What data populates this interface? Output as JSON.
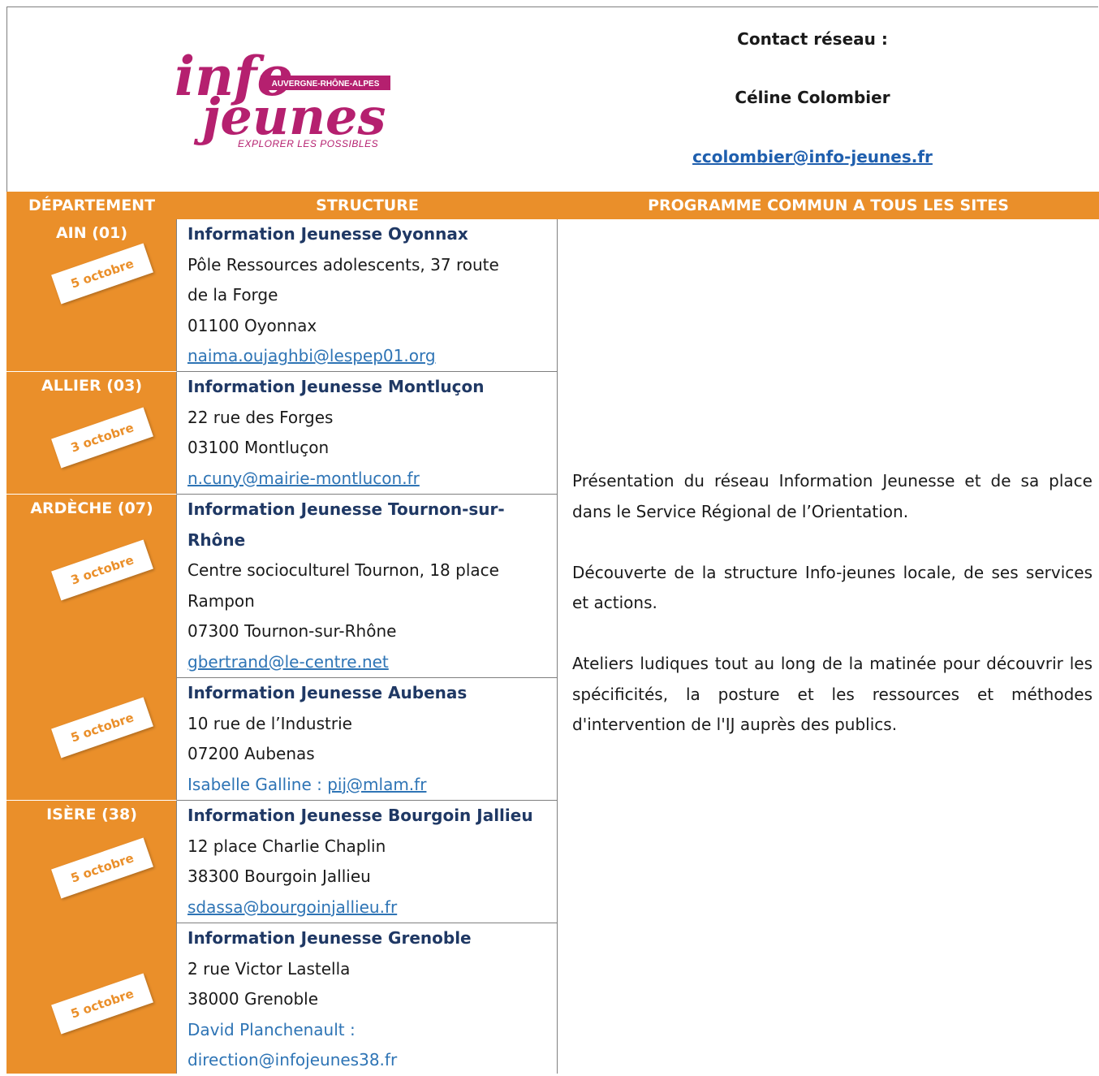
{
  "header": {
    "logo": {
      "word1": "info",
      "word2": "jeunes",
      "region": "AUVERGNE-RHÔNE-ALPES",
      "tagline": "EXPLORER LES POSSIBLES"
    },
    "contact_title": "Contact réseau :",
    "contact_name": "Céline Colombier",
    "contact_email": "ccolombier@info-jeunes.fr"
  },
  "table": {
    "headers": [
      "DÉPARTEMENT",
      "STRUCTURE",
      "PROGRAMME COMMUN A TOUS LES SITES"
    ],
    "rows": [
      {
        "department": "AIN (01)",
        "date": "5 octobre",
        "structure": "Information Jeunesse Oyonnax",
        "lines": [
          "Pôle Ressources adolescents, 37 route",
          "de la Forge",
          "01100 Oyonnax"
        ],
        "email": "naima.oujaghbi@lespep01.org"
      },
      {
        "department": "ALLIER (03)",
        "date": "3 octobre",
        "structure": "Information Jeunesse Montluçon",
        "lines": [
          "22 rue des Forges",
          "03100 Montluçon"
        ],
        "email": "n.cuny@mairie-montlucon.fr"
      },
      {
        "department": "ARDÈCHE (07)",
        "date": "3 octobre",
        "structure_lines": [
          "Information Jeunesse Tournon-sur-",
          "Rhône"
        ],
        "lines": [
          "Centre socioculturel Tournon, 18 place",
          "Rampon",
          "07300 Tournon-sur-Rhône"
        ],
        "email": "gbertrand@le-centre.net"
      },
      {
        "department": "",
        "date": "5 octobre",
        "structure": "Information Jeunesse Aubenas",
        "lines": [
          "10 rue de l’Industrie",
          "07200 Aubenas"
        ],
        "contact_prefix": "Isabelle Galline : ",
        "email": "pij@mlam.fr"
      },
      {
        "department": "ISÈRE (38)",
        "date": "5 octobre",
        "structure": "Information Jeunesse Bourgoin Jallieu",
        "lines": [
          "12 place Charlie Chaplin",
          "38300 Bourgoin Jallieu"
        ],
        "email": "sdassa@bourgoinjallieu.fr"
      },
      {
        "department": "",
        "date": "5 octobre",
        "structure": "Information Jeunesse Grenoble",
        "lines": [
          "2 rue Victor Lastella",
          "38000 Grenoble"
        ],
        "contact_prefix": "David Planchenault :",
        "email": "direction@infojeunes38.fr"
      }
    ],
    "program": [
      "Présentation du réseau Information Jeunesse et de sa place dans le Service Régional de l’Orientation.",
      "Découverte de la structure Info-jeunes locale, de ses services et actions.",
      "Ateliers ludiques tout au long de la matinée pour découvrir les spécificités, la posture et les ressources et méthodes d'intervention de l'IJ auprès des publics."
    ]
  },
  "colors": {
    "accent_orange": "#ea8f2a",
    "logo_magenta": "#b5206f",
    "structure_navy": "#1f3864",
    "link_blue": "#2e74b5"
  }
}
